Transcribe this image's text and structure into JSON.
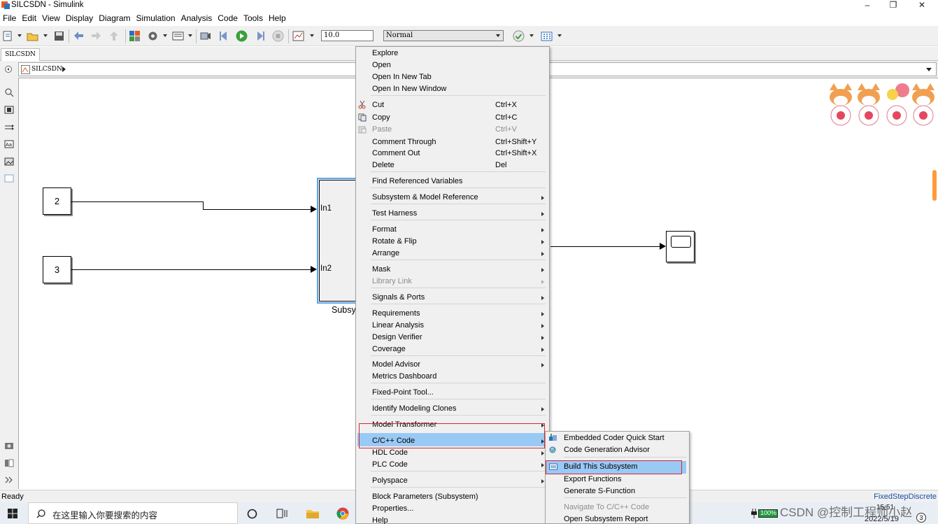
{
  "window": {
    "title": "SILCSDN - Simulink",
    "minimize": "–",
    "maximize": "❐",
    "close": "✕"
  },
  "menubar": [
    "File",
    "Edit",
    "View",
    "Display",
    "Diagram",
    "Simulation",
    "Analysis",
    "Code",
    "Tools",
    "Help"
  ],
  "toolbar": {
    "stop_time": "10.0",
    "sim_mode": "Normal"
  },
  "tab": {
    "label": "SILCSDN"
  },
  "breadcrumb": {
    "label": "SILCSDN"
  },
  "canvas": {
    "const1_value": "2",
    "const2_value": "3",
    "port1": "In1",
    "port2": "In2",
    "subsystem_label": "Subsy"
  },
  "context_menu": {
    "items": [
      {
        "label": "Explore",
        "shortcut": "",
        "submenu": false,
        "disabled": false
      },
      {
        "label": "Open",
        "shortcut": "",
        "submenu": false,
        "disabled": false
      },
      {
        "label": "Open In New Tab",
        "shortcut": "",
        "submenu": false,
        "disabled": false
      },
      {
        "label": "Open In New Window",
        "shortcut": "",
        "submenu": false,
        "disabled": false
      },
      {
        "label": "Cut",
        "shortcut": "Ctrl+X",
        "submenu": false,
        "disabled": false,
        "icon": "scissors-icon"
      },
      {
        "label": "Copy",
        "shortcut": "Ctrl+C",
        "submenu": false,
        "disabled": false,
        "icon": "copy-icon"
      },
      {
        "label": "Paste",
        "shortcut": "Ctrl+V",
        "submenu": false,
        "disabled": true,
        "icon": "paste-icon"
      },
      {
        "label": "Comment Through",
        "shortcut": "Ctrl+Shift+Y",
        "submenu": false,
        "disabled": false
      },
      {
        "label": "Comment Out",
        "shortcut": "Ctrl+Shift+X",
        "submenu": false,
        "disabled": false
      },
      {
        "label": "Delete",
        "shortcut": "Del",
        "submenu": false,
        "disabled": false
      },
      {
        "label": "Find Referenced Variables",
        "shortcut": "",
        "submenu": false,
        "disabled": false
      },
      {
        "label": "Subsystem & Model Reference",
        "shortcut": "",
        "submenu": true,
        "disabled": false
      },
      {
        "label": "Test Harness",
        "shortcut": "",
        "submenu": true,
        "disabled": false
      },
      {
        "label": "Format",
        "shortcut": "",
        "submenu": true,
        "disabled": false
      },
      {
        "label": "Rotate & Flip",
        "shortcut": "",
        "submenu": true,
        "disabled": false
      },
      {
        "label": "Arrange",
        "shortcut": "",
        "submenu": true,
        "disabled": false
      },
      {
        "label": "Mask",
        "shortcut": "",
        "submenu": true,
        "disabled": false
      },
      {
        "label": "Library Link",
        "shortcut": "",
        "submenu": true,
        "disabled": true
      },
      {
        "label": "Signals & Ports",
        "shortcut": "",
        "submenu": true,
        "disabled": false
      },
      {
        "label": "Requirements",
        "shortcut": "",
        "submenu": true,
        "disabled": false
      },
      {
        "label": "Linear Analysis",
        "shortcut": "",
        "submenu": true,
        "disabled": false
      },
      {
        "label": "Design Verifier",
        "shortcut": "",
        "submenu": true,
        "disabled": false
      },
      {
        "label": "Coverage",
        "shortcut": "",
        "submenu": true,
        "disabled": false
      },
      {
        "label": "Model Advisor",
        "shortcut": "",
        "submenu": true,
        "disabled": false
      },
      {
        "label": "Metrics Dashboard",
        "shortcut": "",
        "submenu": false,
        "disabled": false
      },
      {
        "label": "Fixed-Point Tool...",
        "shortcut": "",
        "submenu": false,
        "disabled": false
      },
      {
        "label": "Identify Modeling Clones",
        "shortcut": "",
        "submenu": true,
        "disabled": false
      },
      {
        "label": "Model Transformer",
        "shortcut": "",
        "submenu": true,
        "disabled": false
      },
      {
        "label": "C/C++ Code",
        "shortcut": "",
        "submenu": true,
        "disabled": false,
        "highlighted": true
      },
      {
        "label": "HDL Code",
        "shortcut": "",
        "submenu": true,
        "disabled": false
      },
      {
        "label": "PLC Code",
        "shortcut": "",
        "submenu": true,
        "disabled": false
      },
      {
        "label": "Polyspace",
        "shortcut": "",
        "submenu": true,
        "disabled": false
      },
      {
        "label": "Block Parameters (Subsystem)",
        "shortcut": "",
        "submenu": false,
        "disabled": false
      },
      {
        "label": "Properties...",
        "shortcut": "",
        "submenu": false,
        "disabled": false
      },
      {
        "label": "Help",
        "shortcut": "",
        "submenu": false,
        "disabled": false
      }
    ]
  },
  "submenu": {
    "items": [
      {
        "label": "Embedded Coder Quick Start",
        "disabled": false,
        "icon": "quick-start-icon"
      },
      {
        "label": "Code Generation Advisor",
        "disabled": false,
        "icon": "advisor-icon"
      },
      {
        "label": "Build This Subsystem",
        "disabled": false,
        "highlighted": true,
        "icon": "build-icon"
      },
      {
        "label": "Export Functions",
        "disabled": false
      },
      {
        "label": "Generate S-Function",
        "disabled": false
      },
      {
        "label": "Navigate To C/C++ Code",
        "disabled": true
      },
      {
        "label": "Open Subsystem Report",
        "disabled": false
      }
    ]
  },
  "statusbar": {
    "status": "Ready",
    "solver": "FixedStepDiscrete"
  },
  "taskbar": {
    "search_placeholder": "在这里输入你要搜索的内容",
    "battery": "100%",
    "watermark": "CSDN @控制工程师小赵",
    "time": "15:51",
    "date": "2022/5/19",
    "notifications": "3"
  },
  "colors": {
    "menu_highlight": "#99c9f5",
    "annotation_box": "#d9262e",
    "subsystem_selection": "#5aa5e6"
  }
}
